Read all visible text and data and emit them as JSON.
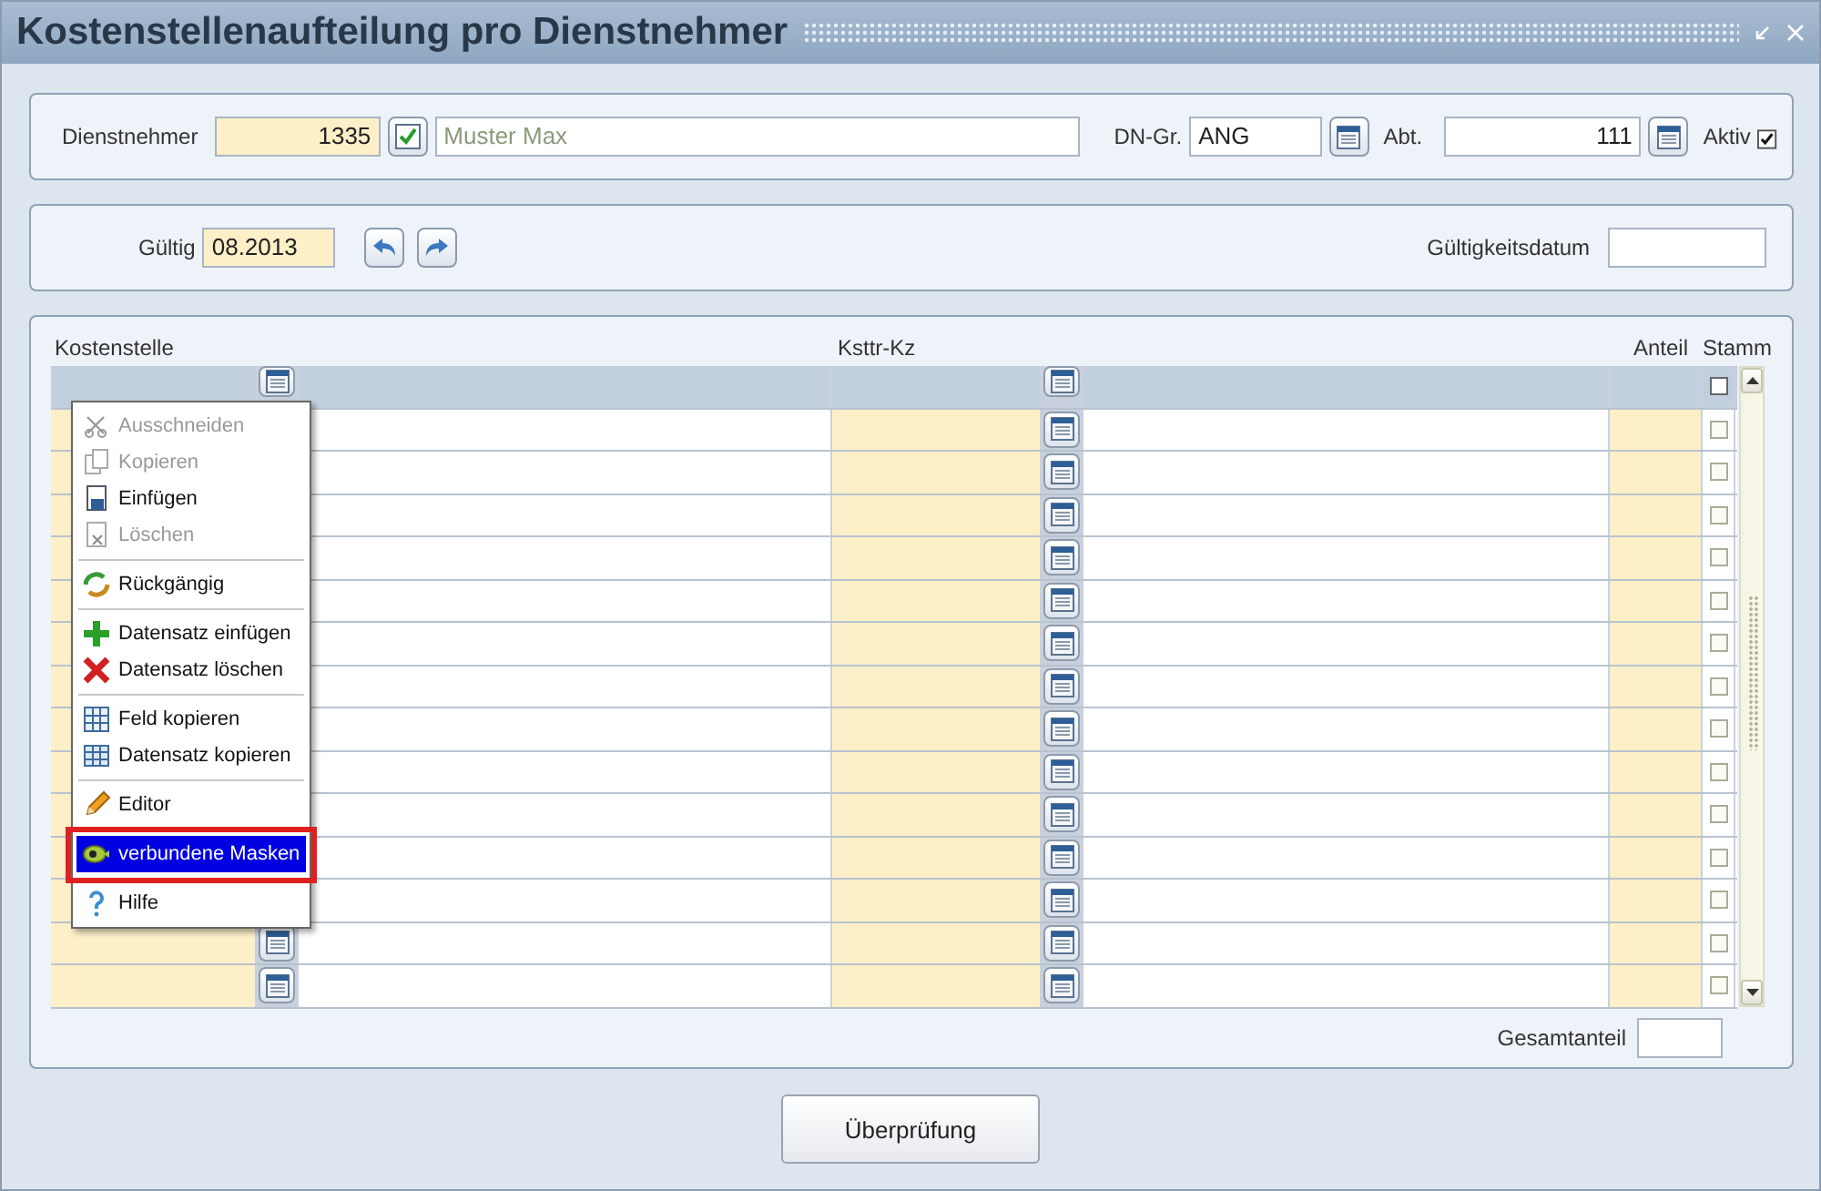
{
  "window": {
    "title": "Kostenstellenaufteilung pro Dienstnehmer"
  },
  "employee": {
    "label": "Dienstnehmer",
    "number": "1335",
    "name": "Muster Max",
    "group_label": "DN-Gr.",
    "group": "ANG",
    "dept_label": "Abt.",
    "dept": "111",
    "active_label": "Aktiv",
    "active": true
  },
  "validity": {
    "label": "Gültig",
    "period": "08.2013",
    "date_label": "Gültigkeitsdatum"
  },
  "grid": {
    "columns": [
      "Kostenstelle",
      "Ksttr-Kz",
      "Anteil",
      "Stamm"
    ],
    "rows": [
      {
        "selected": true,
        "stamm": false
      },
      {
        "selected": false,
        "stamm": false
      },
      {
        "selected": false,
        "stamm": false
      },
      {
        "selected": false,
        "stamm": false
      },
      {
        "selected": false,
        "stamm": false
      },
      {
        "selected": false,
        "stamm": false
      },
      {
        "selected": false,
        "stamm": false
      },
      {
        "selected": false,
        "stamm": false
      },
      {
        "selected": false,
        "stamm": false
      },
      {
        "selected": false,
        "stamm": false
      },
      {
        "selected": false,
        "stamm": false
      },
      {
        "selected": false,
        "stamm": false
      },
      {
        "selected": false,
        "stamm": false
      },
      {
        "selected": false,
        "stamm": false
      },
      {
        "selected": false,
        "stamm": false
      }
    ],
    "total_label": "Gesamtanteil"
  },
  "context_menu": {
    "items": [
      {
        "kind": "item",
        "label": "Ausschneiden",
        "disabled": true,
        "selected": false
      },
      {
        "kind": "item",
        "label": "Kopieren",
        "disabled": true,
        "selected": false
      },
      {
        "kind": "item",
        "label": "Einfügen",
        "disabled": false,
        "selected": false
      },
      {
        "kind": "item",
        "label": "Löschen",
        "disabled": true,
        "selected": false
      },
      {
        "kind": "separator"
      },
      {
        "kind": "item",
        "label": "Rückgängig",
        "disabled": false,
        "selected": false
      },
      {
        "kind": "separator"
      },
      {
        "kind": "item",
        "label": "Datensatz einfügen",
        "disabled": false,
        "selected": false
      },
      {
        "kind": "item",
        "label": "Datensatz löschen",
        "disabled": false,
        "selected": false
      },
      {
        "kind": "separator"
      },
      {
        "kind": "item",
        "label": "Feld kopieren",
        "disabled": false,
        "selected": false
      },
      {
        "kind": "item",
        "label": "Datensatz kopieren",
        "disabled": false,
        "selected": false
      },
      {
        "kind": "separator"
      },
      {
        "kind": "item",
        "label": "Editor",
        "disabled": false,
        "selected": false
      },
      {
        "kind": "separator"
      },
      {
        "kind": "item",
        "label": "verbundene Masken",
        "disabled": false,
        "selected": true,
        "highlighted_box": true
      },
      {
        "kind": "separator"
      },
      {
        "kind": "item",
        "label": "Hilfe",
        "disabled": false,
        "selected": false
      }
    ]
  },
  "check_button": "Überprüfung"
}
